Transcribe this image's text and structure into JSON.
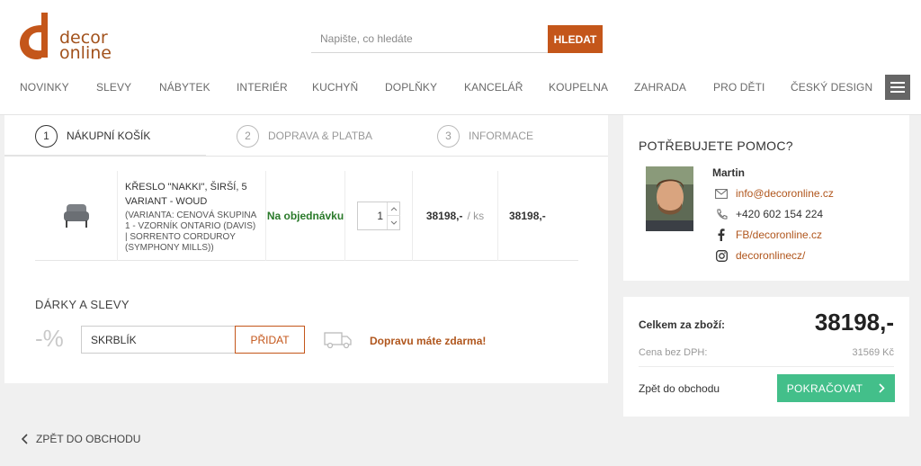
{
  "brand": {
    "logo_line1": "decor",
    "logo_line2": "online",
    "accent": "#c4561a"
  },
  "search": {
    "placeholder": "Napište, co hledáte",
    "button_label": "HLEDAT"
  },
  "nav": {
    "items": [
      "NOVINKY",
      "SLEVY",
      "NÁBYTEK",
      "INTERIÉR",
      "KUCHYŇ",
      "DOPLŇKY",
      "KANCELÁŘ",
      "KOUPELNA",
      "ZAHRADA",
      "PRO DĚTI",
      "ČESKÝ DESIGN"
    ],
    "menu_icon": "hamburger-icon"
  },
  "steps": [
    {
      "num": "1",
      "label": "NÁKUPNÍ KOŠÍK",
      "active": true
    },
    {
      "num": "2",
      "label": "DOPRAVA & PLATBA",
      "active": false
    },
    {
      "num": "3",
      "label": "INFORMACE",
      "active": false
    }
  ],
  "cart_item": {
    "name": "KŘESLO \"NAKKI\", ŠIRŠÍ, 5 VARIANT - WOUD",
    "variant": "(VARIANTA: CENOVÁ SKUPINA 1 - VZORNÍK ONTARIO (DAVIS) | SORRENTO CORDUROY (SYMPHONY MILLS))",
    "availability": "Na objednávku",
    "quantity": "1",
    "unit_price": "38198,-",
    "unit_suffix": "/ ks",
    "total_price": "38198,-"
  },
  "gifts": {
    "title": "DÁRKY A SLEVY",
    "percent_symbol": "-%",
    "coupon_value": "SKRBLÍK",
    "add_button": "PŘIDAT",
    "free_shipping": "Dopravu máte zdarma!"
  },
  "back_link": "ZPĚT DO OBCHODU",
  "help": {
    "title": "POTŘEBUJETE POMOC?",
    "agent_name": "Martin",
    "email": "info@decoronline.cz",
    "phone": "+420 602 154 224",
    "facebook": "FB/decoronline.cz",
    "instagram": "decoronlinecz/"
  },
  "summary": {
    "total_label": "Celkem za zboží:",
    "total_value": "38198,-",
    "vat_label": "Cena bez DPH:",
    "vat_value": "31569 Kč",
    "back_label": "Zpět do obchodu",
    "continue_label": "POKRAČOVAT",
    "continue_color": "#43bf8a"
  }
}
